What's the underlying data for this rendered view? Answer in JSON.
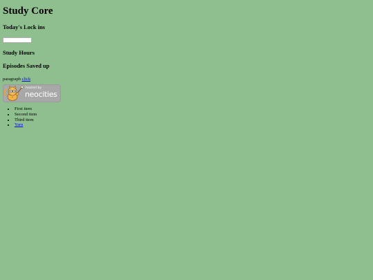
{
  "page": {
    "title": "Study Core",
    "sections": {
      "lock_ins": "Today's Lock ins",
      "study_hours": "Study Hours",
      "episodes": "Episodes Saved up"
    },
    "input": {
      "value": "",
      "placeholder": ""
    },
    "paragraph": {
      "text": "paragraph",
      "link_label": "click"
    }
  },
  "badge": {
    "hosted_by": "hosted by",
    "brand": "neocities",
    "icon": "neocities-cat-icon",
    "background": "#a8a8a8"
  },
  "list": {
    "items": [
      "First item",
      "Second item",
      "Third item"
    ],
    "link_item": "Yarn"
  },
  "colors": {
    "background": "#8fbf8f",
    "link": "#0000ee"
  }
}
